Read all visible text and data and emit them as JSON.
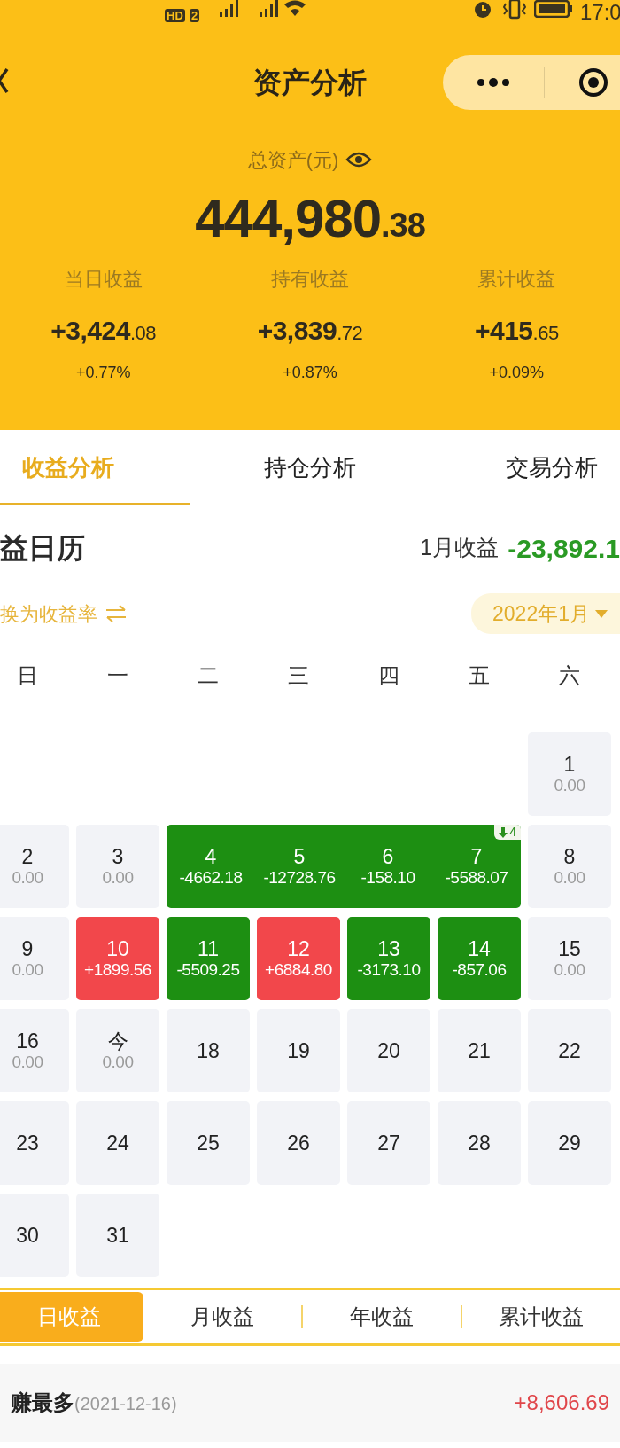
{
  "status_bar": {
    "hd": "HD",
    "sim": "2",
    "time": "17:0"
  },
  "nav": {
    "title": "资产分析"
  },
  "summary": {
    "label": "总资产(元)",
    "total": {
      "main": "444,980",
      "fraction": ".38"
    },
    "stats": [
      {
        "label": "当日收益",
        "value": {
          "main": "+3,424",
          "fraction": ".08"
        },
        "rate": "+0.77%"
      },
      {
        "label": "持有收益",
        "value": {
          "main": "+3,839",
          "fraction": ".72"
        },
        "rate": "+0.87%"
      },
      {
        "label": "累计收益",
        "value": {
          "main": "+415",
          "fraction": ".65"
        },
        "rate": "+0.09%"
      }
    ]
  },
  "tabs": [
    {
      "label": "收益分析",
      "selected": true
    },
    {
      "label": "持仓分析",
      "selected": false
    },
    {
      "label": "交易分析",
      "selected": false
    }
  ],
  "calendar": {
    "title": "益日历",
    "month_label": "1月收益",
    "month_value": "-23,892.1",
    "toggle": "换为收益率",
    "month_picker": "2022年1月",
    "weekdays": [
      "日",
      "一",
      "二",
      "三",
      "四",
      "五",
      "六"
    ],
    "weeks": [
      [
        {
          "kind": "blank"
        },
        {
          "kind": "blank"
        },
        {
          "kind": "blank"
        },
        {
          "kind": "blank"
        },
        {
          "kind": "blank"
        },
        {
          "kind": "blank"
        },
        {
          "kind": "flat",
          "day": "1",
          "value": "0.00"
        }
      ],
      [
        {
          "kind": "flat",
          "day": "2",
          "value": "0.00"
        },
        {
          "kind": "flat",
          "day": "3",
          "value": "0.00"
        },
        {
          "kind": "streak",
          "rising": false,
          "badge": "4",
          "days": [
            {
              "day": "4",
              "value": "-4662.18"
            },
            {
              "day": "5",
              "value": "-12728.76"
            },
            {
              "day": "6",
              "value": "-158.10"
            },
            {
              "day": "7",
              "value": "-5588.07"
            }
          ]
        },
        {
          "kind": "flat",
          "day": "8",
          "value": "0.00"
        }
      ],
      [
        {
          "kind": "flat",
          "day": "9",
          "value": "0.00"
        },
        {
          "kind": "up",
          "day": "10",
          "value": "+1899.56"
        },
        {
          "kind": "down",
          "day": "11",
          "value": "-5509.25"
        },
        {
          "kind": "up",
          "day": "12",
          "value": "+6884.80"
        },
        {
          "kind": "down",
          "day": "13",
          "value": "-3173.10"
        },
        {
          "kind": "down",
          "day": "14",
          "value": "-857.06"
        },
        {
          "kind": "flat",
          "day": "15",
          "value": "0.00"
        }
      ],
      [
        {
          "kind": "flat",
          "day": "16",
          "value": "0.00"
        },
        {
          "kind": "flat",
          "day": "今",
          "value": "0.00"
        },
        {
          "kind": "future",
          "day": "18"
        },
        {
          "kind": "future",
          "day": "19"
        },
        {
          "kind": "future",
          "day": "20"
        },
        {
          "kind": "future",
          "day": "21"
        },
        {
          "kind": "future",
          "day": "22"
        }
      ],
      [
        {
          "kind": "future",
          "day": "23"
        },
        {
          "kind": "future",
          "day": "24"
        },
        {
          "kind": "future",
          "day": "25"
        },
        {
          "kind": "future",
          "day": "26"
        },
        {
          "kind": "future",
          "day": "27"
        },
        {
          "kind": "future",
          "day": "28"
        },
        {
          "kind": "future",
          "day": "29"
        }
      ],
      [
        {
          "kind": "future",
          "day": "30"
        },
        {
          "kind": "future",
          "day": "31"
        }
      ]
    ]
  },
  "period_tabs": [
    {
      "label": "日收益",
      "selected": true
    },
    {
      "label": "月收益",
      "selected": false
    },
    {
      "label": "年收益",
      "selected": false
    },
    {
      "label": "累计收益",
      "selected": false
    }
  ],
  "best": {
    "label": "赚最多",
    "date": "(2021-12-16)",
    "value": "+8,606.69"
  }
}
